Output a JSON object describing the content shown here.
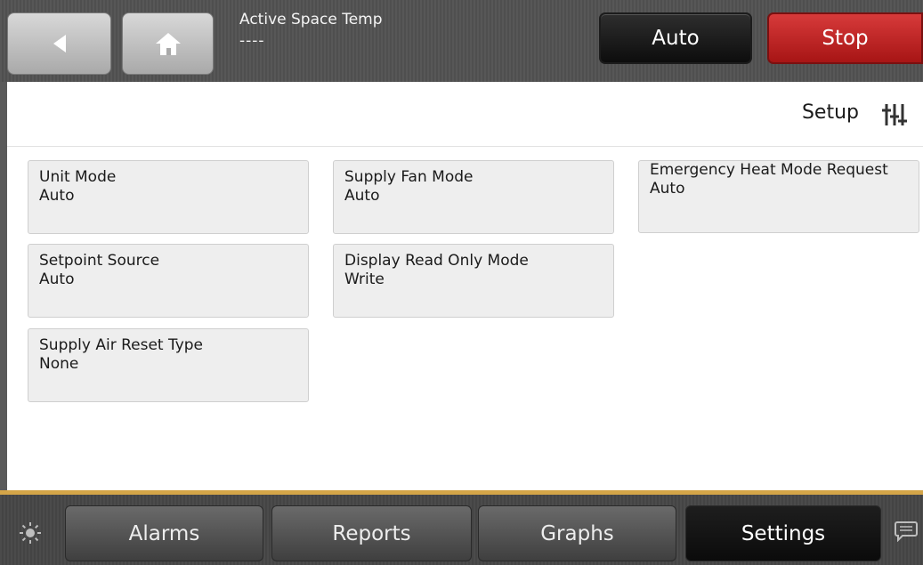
{
  "header": {
    "title": "Active Space Temp",
    "value": "----",
    "mode_label": "Auto",
    "stop_label": "Stop"
  },
  "page": {
    "title": "Setup"
  },
  "tiles": [
    {
      "name": "Unit Mode",
      "value": "Auto"
    },
    {
      "name": "Supply Fan Mode",
      "value": "Auto"
    },
    {
      "name": "Emergency Heat Mode Request",
      "value": "Auto"
    },
    {
      "name": "Setpoint Source",
      "value": "Auto"
    },
    {
      "name": "Display Read Only Mode",
      "value": "Write"
    },
    {
      "name": "Supply Air Reset Type",
      "value": "None"
    }
  ],
  "bottom_tabs": [
    {
      "label": "Alarms"
    },
    {
      "label": "Reports"
    },
    {
      "label": "Graphs"
    },
    {
      "label": "Settings",
      "active": true
    }
  ],
  "icons": {
    "back": "back-arrow-icon",
    "home": "home-icon",
    "setup": "sliders-icon",
    "brightness": "brightness-icon",
    "chat": "chat-bubble-icon"
  },
  "colors": {
    "stop_red": "#c62828",
    "accent_gold": "#d4a548",
    "mode_black": "#111111"
  }
}
